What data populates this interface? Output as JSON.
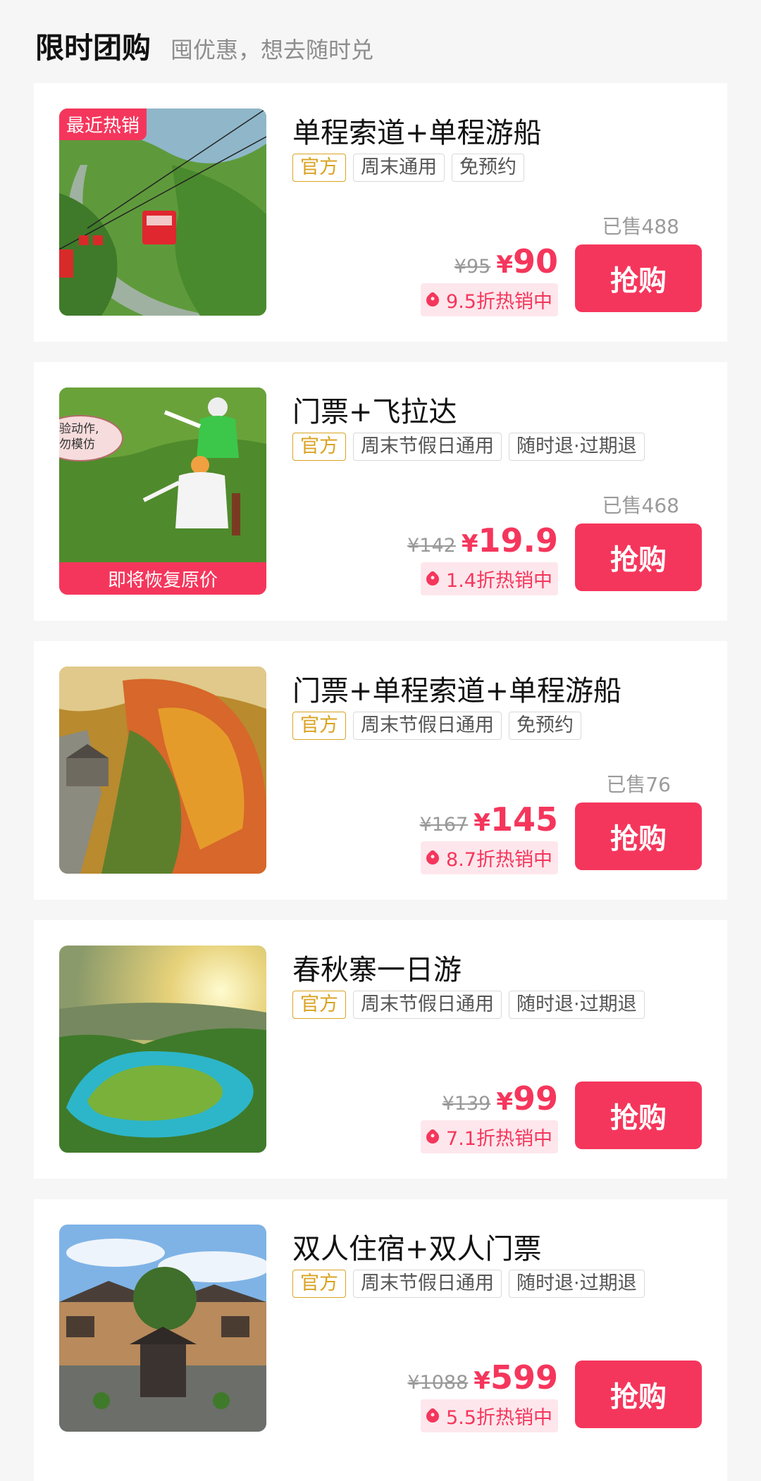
{
  "header": {
    "title": "限时团购",
    "subtitle": "囤优惠，想去随时兑"
  },
  "buy_label": "抢购",
  "colors": {
    "accent": "#f5365c",
    "official": "#d9a322"
  },
  "products": [
    {
      "name": "单程索道+单程游船",
      "tags": [
        "官方",
        "周末通用",
        "免预约"
      ],
      "badge_top": "最近热销",
      "badge_bottom": "",
      "sold": "已售488",
      "original_price": "¥95",
      "price_symbol": "¥",
      "price": "90",
      "discount": "9.5折热销中",
      "image": "cable-car-valley"
    },
    {
      "name": "门票+飞拉达",
      "tags": [
        "官方",
        "周末节假日通用",
        "随时退·过期退"
      ],
      "badge_top": "",
      "badge_bottom": "即将恢复原价",
      "sold": "已售468",
      "original_price": "¥142",
      "price_symbol": "¥",
      "price": "19.9",
      "discount": "1.4折热销中",
      "image": "via-ferrata-climbers",
      "image_bubble": [
        "验动作,",
        "勿模仿"
      ]
    },
    {
      "name": "门票+单程索道+单程游船",
      "tags": [
        "官方",
        "周末节假日通用",
        "免预约"
      ],
      "badge_top": "",
      "badge_bottom": "",
      "sold": "已售76",
      "original_price": "¥167",
      "price_symbol": "¥",
      "price": "145",
      "discount": "8.7折热销中",
      "image": "autumn-cliff"
    },
    {
      "name": "春秋寨一日游",
      "tags": [
        "官方",
        "周末节假日通用",
        "随时退·过期退"
      ],
      "badge_top": "",
      "badge_bottom": "",
      "sold": "",
      "original_price": "¥139",
      "price_symbol": "¥",
      "price": "99",
      "discount": "7.1折热销中",
      "image": "river-bend-sunrise"
    },
    {
      "name": "双人住宿+双人门票",
      "tags": [
        "官方",
        "周末节假日通用",
        "随时退·过期退"
      ],
      "badge_top": "",
      "badge_bottom": "",
      "sold": "",
      "original_price": "¥1088",
      "price_symbol": "¥",
      "price": "599",
      "discount": "5.5折热销中",
      "image": "village-house"
    }
  ]
}
